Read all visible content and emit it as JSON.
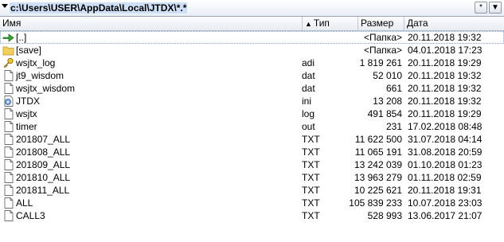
{
  "path": "c:\\Users\\USER\\AppData\\Local\\JTDX\\*.*",
  "toolbar": {
    "btn1": "*",
    "btn2": "▼"
  },
  "columns": {
    "name": "Имя",
    "type": "Тип",
    "size": "Размер",
    "date": "Дата"
  },
  "rows": [
    {
      "name": "[..]",
      "ext": "",
      "size": "<Папка>",
      "date": "20.11.2018 19:32",
      "icon": "up-arrow-icon"
    },
    {
      "name": "[save]",
      "ext": "",
      "size": "<Папка>",
      "date": "04.01.2018 17:23",
      "icon": "folder-icon"
    },
    {
      "name": "wsjtx_log",
      "ext": "adi",
      "size": "1 819 261",
      "date": "20.11.2018 19:29",
      "icon": "key-file-icon"
    },
    {
      "name": "jt9_wisdom",
      "ext": "dat",
      "size": "52 010",
      "date": "20.11.2018 19:32",
      "icon": "file-icon"
    },
    {
      "name": "wsjtx_wisdom",
      "ext": "dat",
      "size": "661",
      "date": "20.11.2018 19:32",
      "icon": "file-icon"
    },
    {
      "name": "JTDX",
      "ext": "ini",
      "size": "13 208",
      "date": "20.11.2018 19:32",
      "icon": "settings-file-icon"
    },
    {
      "name": "wsjtx",
      "ext": "log",
      "size": "491 854",
      "date": "20.11.2018 19:29",
      "icon": "file-icon"
    },
    {
      "name": "timer",
      "ext": "out",
      "size": "231",
      "date": "17.02.2018 08:48",
      "icon": "file-icon"
    },
    {
      "name": "201807_ALL",
      "ext": "TXT",
      "size": "11 622 500",
      "date": "31.07.2018 04:14",
      "icon": "file-icon"
    },
    {
      "name": "201808_ALL",
      "ext": "TXT",
      "size": "11 065 191",
      "date": "31.08.2018 20:59",
      "icon": "file-icon"
    },
    {
      "name": "201809_ALL",
      "ext": "TXT",
      "size": "13 242 039",
      "date": "01.10.2018 01:23",
      "icon": "file-icon"
    },
    {
      "name": "201810_ALL",
      "ext": "TXT",
      "size": "13 963 279",
      "date": "01.11.2018 02:59",
      "icon": "file-icon"
    },
    {
      "name": "201811_ALL",
      "ext": "TXT",
      "size": "10 225 621",
      "date": "20.11.2018 19:31",
      "icon": "file-icon"
    },
    {
      "name": "ALL",
      "ext": "TXT",
      "size": "105 839 233",
      "date": "10.07.2018 23:03",
      "icon": "file-icon"
    },
    {
      "name": "CALL3",
      "ext": "TXT",
      "size": "528 993",
      "date": "13.06.2017 21:07",
      "icon": "file-icon"
    }
  ]
}
